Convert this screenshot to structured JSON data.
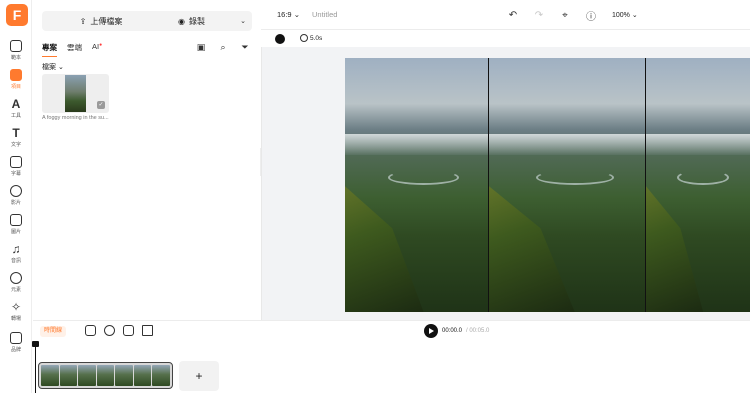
{
  "app": {
    "logo_letter": "F",
    "brand_color": "#ff7a2e"
  },
  "rail": {
    "items": [
      {
        "icon": "template-icon",
        "label": "範本"
      },
      {
        "icon": "upload-icon",
        "label": "項目"
      },
      {
        "icon": "ai-tools-icon",
        "label": "工具"
      },
      {
        "icon": "text-icon",
        "label": "文字"
      },
      {
        "icon": "subtitle-icon",
        "label": "字幕"
      },
      {
        "icon": "video-icon",
        "label": "影片"
      },
      {
        "icon": "image-icon",
        "label": "圖片"
      },
      {
        "icon": "audio-icon",
        "label": "音訊"
      },
      {
        "icon": "elements-icon",
        "label": "元素"
      },
      {
        "icon": "effects-icon",
        "label": "轉場"
      },
      {
        "icon": "brand-icon",
        "label": "品牌"
      }
    ],
    "active_index": 1
  },
  "panel": {
    "upload_label": "上傳檔案",
    "record_label": "錄製",
    "tabs": [
      {
        "label": "專案",
        "active": true
      },
      {
        "label": "雲端",
        "active": false
      },
      {
        "label": "AI",
        "active": false
      }
    ],
    "folder_label": "檔案",
    "media": [
      {
        "name": "A foggy morning in the su..."
      }
    ]
  },
  "topbar": {
    "aspect_ratio": "16:9",
    "title": "Untitled",
    "zoom": "100%"
  },
  "toolstrip": {
    "background_color": "#111111",
    "duration": "5.0s"
  },
  "timeline": {
    "tag_label": "時間線",
    "current_time": "00:00.0",
    "total_time": "/ 00:05.0",
    "add_label": "+"
  }
}
